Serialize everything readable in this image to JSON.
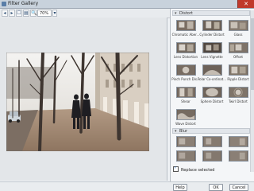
{
  "window": {
    "title": "Filter Gallery",
    "close_glyph": "✕"
  },
  "toolbar": {
    "buttons": [
      "◂",
      "▸",
      "☐",
      "▤"
    ],
    "zoom_icon": "🔍",
    "zoom_value": "70%",
    "zoom_dropdown": "▾"
  },
  "panel": {
    "group_main": {
      "label": "Distort",
      "chevron": "▾"
    },
    "thumbs": [
      {
        "label": "Chromatic Aber..."
      },
      {
        "label": "Cylinder Distort"
      },
      {
        "label": "Glass"
      },
      {
        "label": "Lens Distortion"
      },
      {
        "label": "Lens Vignette"
      },
      {
        "label": "Offset"
      },
      {
        "label": "Pinch Punch Dis..."
      },
      {
        "label": "Polar Co-ordinat..."
      },
      {
        "label": "Ripple Distort"
      },
      {
        "label": "Shear"
      },
      {
        "label": "Sphere Distort"
      },
      {
        "label": "Twirl Distort"
      },
      {
        "label": "Wave Distort"
      }
    ],
    "group_blur": {
      "label": "Blur",
      "chevron": "▾"
    }
  },
  "replace": {
    "label": "Replace selected",
    "checked": true
  },
  "buttons": {
    "help": "Help",
    "ok": "OK",
    "cancel": "Cancel"
  }
}
